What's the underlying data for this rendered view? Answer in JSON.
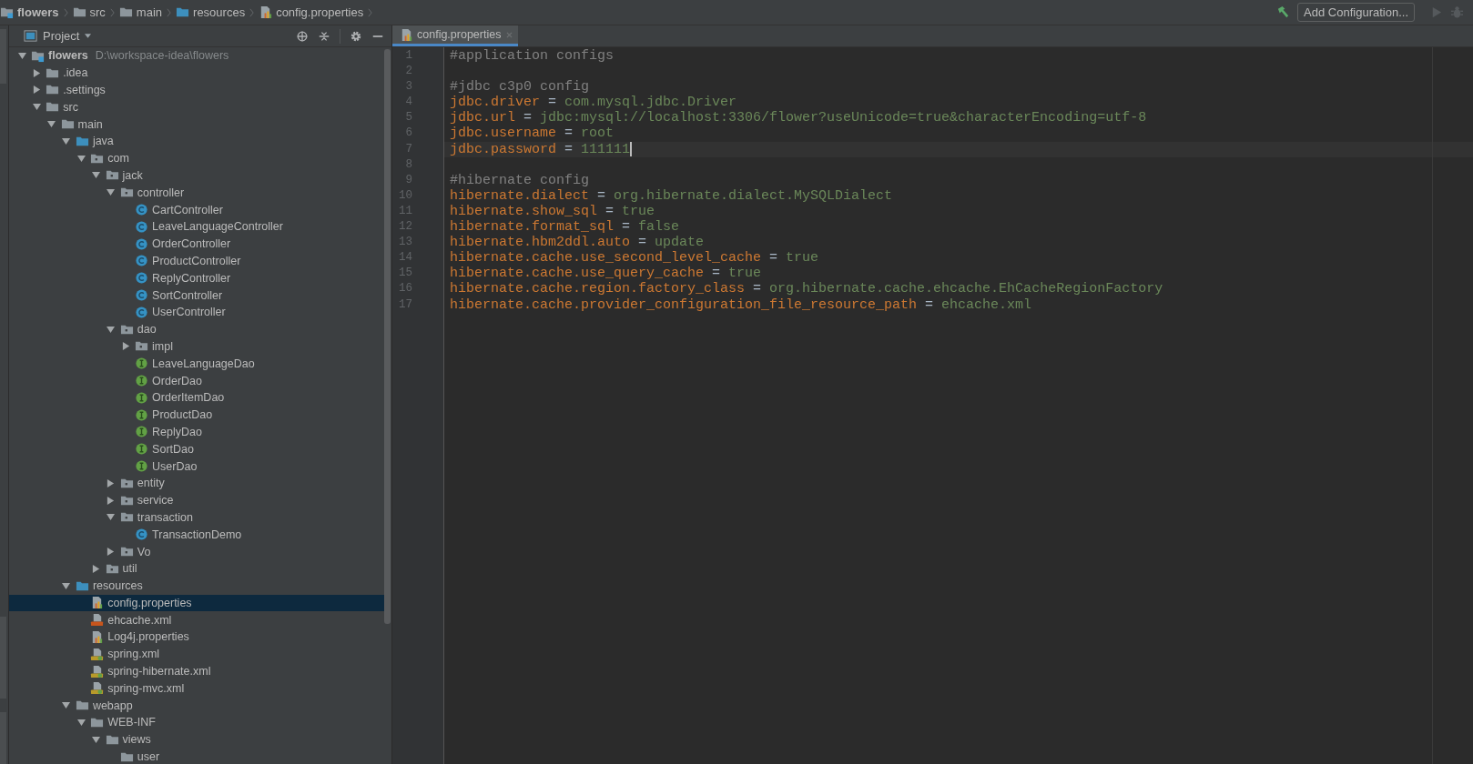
{
  "breadcrumbs": [
    {
      "label": "flowers",
      "kind": "module"
    },
    {
      "label": "src",
      "kind": "folder"
    },
    {
      "label": "main",
      "kind": "folder"
    },
    {
      "label": "resources",
      "kind": "resource-folder"
    },
    {
      "label": "config.properties",
      "kind": "properties"
    }
  ],
  "toolbar": {
    "run_configuration": "Add Configuration...",
    "actions": [
      {
        "kind": "build",
        "disabled": false
      },
      {
        "kind": "run",
        "disabled": true
      },
      {
        "kind": "debug",
        "disabled": true
      }
    ]
  },
  "project_panel": {
    "title": "Project",
    "tree": [
      {
        "label": "flowers",
        "path": "D:\\workspace-idea\\flowers",
        "kind": "module",
        "expanded": true,
        "selected": false,
        "children": [
          {
            "label": ".idea",
            "kind": "folder",
            "expanded": false,
            "selected": false
          },
          {
            "label": ".settings",
            "kind": "folder",
            "expanded": false,
            "selected": false
          },
          {
            "label": "src",
            "kind": "folder",
            "expanded": true,
            "selected": false,
            "children": [
              {
                "label": "main",
                "kind": "folder",
                "expanded": true,
                "selected": false,
                "children": [
                  {
                    "label": "java",
                    "kind": "source-folder",
                    "expanded": true,
                    "selected": false,
                    "children": [
                      {
                        "label": "com",
                        "kind": "package",
                        "expanded": true,
                        "selected": false,
                        "children": [
                          {
                            "label": "jack",
                            "kind": "package",
                            "expanded": true,
                            "selected": false,
                            "children": [
                              {
                                "label": "controller",
                                "kind": "package",
                                "expanded": true,
                                "selected": false,
                                "children": [
                                  {
                                    "label": "CartController",
                                    "kind": "class",
                                    "selected": false
                                  },
                                  {
                                    "label": "LeaveLanguageController",
                                    "kind": "class",
                                    "selected": false
                                  },
                                  {
                                    "label": "OrderController",
                                    "kind": "class",
                                    "selected": false
                                  },
                                  {
                                    "label": "ProductController",
                                    "kind": "class",
                                    "selected": false
                                  },
                                  {
                                    "label": "ReplyController",
                                    "kind": "class",
                                    "selected": false
                                  },
                                  {
                                    "label": "SortController",
                                    "kind": "class",
                                    "selected": false
                                  },
                                  {
                                    "label": "UserController",
                                    "kind": "class",
                                    "selected": false
                                  }
                                ]
                              },
                              {
                                "label": "dao",
                                "kind": "package",
                                "expanded": true,
                                "selected": false,
                                "children": [
                                  {
                                    "label": "impl",
                                    "kind": "package",
                                    "expanded": false,
                                    "selected": false
                                  },
                                  {
                                    "label": "LeaveLanguageDao",
                                    "kind": "interface",
                                    "selected": false
                                  },
                                  {
                                    "label": "OrderDao",
                                    "kind": "interface",
                                    "selected": false
                                  },
                                  {
                                    "label": "OrderItemDao",
                                    "kind": "interface",
                                    "selected": false
                                  },
                                  {
                                    "label": "ProductDao",
                                    "kind": "interface",
                                    "selected": false
                                  },
                                  {
                                    "label": "ReplyDao",
                                    "kind": "interface",
                                    "selected": false
                                  },
                                  {
                                    "label": "SortDao",
                                    "kind": "interface",
                                    "selected": false
                                  },
                                  {
                                    "label": "UserDao",
                                    "kind": "interface",
                                    "selected": false
                                  }
                                ]
                              },
                              {
                                "label": "entity",
                                "kind": "package",
                                "expanded": false,
                                "selected": false
                              },
                              {
                                "label": "service",
                                "kind": "package",
                                "expanded": false,
                                "selected": false
                              },
                              {
                                "label": "transaction",
                                "kind": "package",
                                "expanded": true,
                                "selected": false,
                                "children": [
                                  {
                                    "label": "TransactionDemo",
                                    "kind": "class",
                                    "selected": false
                                  }
                                ]
                              },
                              {
                                "label": "Vo",
                                "kind": "package",
                                "expanded": false,
                                "selected": false
                              }
                            ]
                          },
                          {
                            "label": "util",
                            "kind": "package",
                            "expanded": false,
                            "selected": false
                          }
                        ]
                      }
                    ]
                  },
                  {
                    "label": "resources",
                    "kind": "resource-folder",
                    "expanded": true,
                    "selected": false,
                    "children": [
                      {
                        "label": "config.properties",
                        "kind": "properties",
                        "selected": true
                      },
                      {
                        "label": "ehcache.xml",
                        "kind": "xml",
                        "selected": false
                      },
                      {
                        "label": "Log4j.properties",
                        "kind": "properties",
                        "selected": false
                      },
                      {
                        "label": "spring.xml",
                        "kind": "spring-xml",
                        "selected": false
                      },
                      {
                        "label": "spring-hibernate.xml",
                        "kind": "spring-xml",
                        "selected": false
                      },
                      {
                        "label": "spring-mvc.xml",
                        "kind": "spring-xml",
                        "selected": false
                      }
                    ]
                  },
                  {
                    "label": "webapp",
                    "kind": "folder",
                    "expanded": true,
                    "selected": false,
                    "children": [
                      {
                        "label": "WEB-INF",
                        "kind": "folder",
                        "expanded": true,
                        "selected": false,
                        "children": [
                          {
                            "label": "views",
                            "kind": "folder",
                            "expanded": true,
                            "selected": false,
                            "children": [
                              {
                                "label": "user",
                                "kind": "folder",
                                "selected": false
                              }
                            ]
                          }
                        ]
                      }
                    ]
                  }
                ]
              }
            ]
          }
        ]
      }
    ]
  },
  "editor": {
    "tabs": [
      {
        "label": "config.properties",
        "selected": true
      }
    ],
    "lines": [
      {
        "number": "1",
        "kind": "comment",
        "text": "#application configs",
        "current": false
      },
      {
        "number": "2",
        "kind": "blank",
        "current": false
      },
      {
        "number": "3",
        "kind": "comment",
        "text": "#jdbc c3p0 config",
        "current": false
      },
      {
        "number": "4",
        "kind": "pair",
        "key": "jdbc.driver",
        "operator": "=",
        "value": "com.mysql.jdbc.Driver",
        "current": false
      },
      {
        "number": "5",
        "kind": "pair",
        "key": "jdbc.url",
        "operator": "=",
        "value": "jdbc:mysql://localhost:3306/flower?useUnicode=true&characterEncoding=utf-8",
        "current": false
      },
      {
        "number": "6",
        "kind": "pair",
        "key": "jdbc.username",
        "operator": "=",
        "value": "root",
        "current": false
      },
      {
        "number": "7",
        "kind": "pair",
        "key": "jdbc.password",
        "operator": "=",
        "value": "111111",
        "current": true
      },
      {
        "number": "8",
        "kind": "blank",
        "current": false
      },
      {
        "number": "9",
        "kind": "comment",
        "text": "#hibernate config",
        "current": false
      },
      {
        "number": "10",
        "kind": "pair",
        "key": "hibernate.dialect",
        "operator": "=",
        "value": "org.hibernate.dialect.MySQLDialect",
        "current": false
      },
      {
        "number": "11",
        "kind": "pair",
        "key": "hibernate.show_sql",
        "operator": "=",
        "value": "true",
        "current": false
      },
      {
        "number": "12",
        "kind": "pair",
        "key": "hibernate.format_sql",
        "operator": "=",
        "value": "false",
        "current": false
      },
      {
        "number": "13",
        "kind": "pair",
        "key": "hibernate.hbm2ddl.auto",
        "operator": "=",
        "value": "update",
        "current": false
      },
      {
        "number": "14",
        "kind": "pair",
        "key": "hibernate.cache.use_second_level_cache",
        "operator": "=",
        "value": "true",
        "current": false
      },
      {
        "number": "15",
        "kind": "pair",
        "key": "hibernate.cache.use_query_cache",
        "operator": "=",
        "value": "true",
        "current": false
      },
      {
        "number": "16",
        "kind": "pair",
        "key": "hibernate.cache.region.factory_class",
        "operator": "=",
        "value": "org.hibernate.cache.ehcache.EhCacheRegionFactory",
        "current": false
      },
      {
        "number": "17",
        "kind": "pair",
        "key": "hibernate.cache.provider_configuration_file_resource_path",
        "operator": "=",
        "value": "ehcache.xml",
        "current": false
      }
    ]
  }
}
